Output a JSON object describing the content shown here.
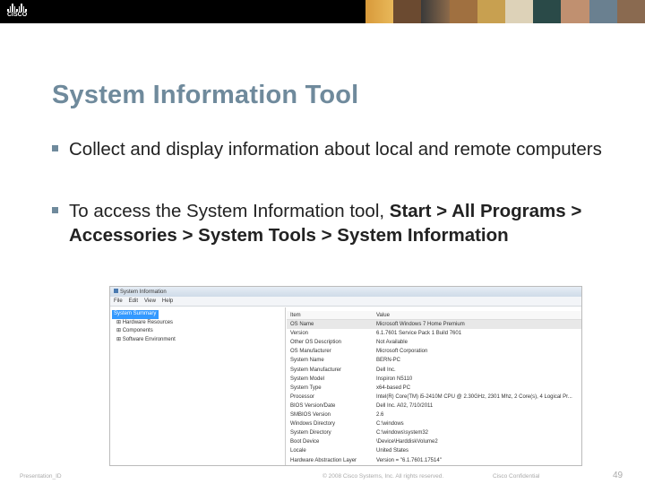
{
  "header": {
    "logo_text": "CISCO"
  },
  "title": "System Information Tool",
  "bullets": [
    {
      "text": "Collect and display information about local and remote computers"
    },
    {
      "text_plain": "To access the System Information tool, ",
      "text_bold": "Start > All Programs > Accessories > System Tools > System Information"
    }
  ],
  "screenshot": {
    "window_title": "System Information",
    "menu": [
      "File",
      "Edit",
      "View",
      "Help"
    ],
    "tree": [
      "System Summary",
      "Hardware Resources",
      "Components",
      "Software Environment"
    ],
    "columns": [
      "Item",
      "Value"
    ],
    "rows": [
      [
        "OS Name",
        "Microsoft Windows 7 Home Premium"
      ],
      [
        "Version",
        "6.1.7601 Service Pack 1 Build 7601"
      ],
      [
        "Other OS Description",
        "Not Available"
      ],
      [
        "OS Manufacturer",
        "Microsoft Corporation"
      ],
      [
        "System Name",
        "BERN-PC"
      ],
      [
        "System Manufacturer",
        "Dell Inc."
      ],
      [
        "System Model",
        "Inspiron N5110"
      ],
      [
        "System Type",
        "x64-based PC"
      ],
      [
        "Processor",
        "Intel(R) Core(TM) i5-2410M CPU @ 2.30GHz, 2301 Mhz, 2 Core(s), 4 Logical Pr..."
      ],
      [
        "BIOS Version/Date",
        "Dell Inc. A02, 7/10/2011"
      ],
      [
        "SMBIOS Version",
        "2.6"
      ],
      [
        "Windows Directory",
        "C:\\windows"
      ],
      [
        "System Directory",
        "C:\\windows\\system32"
      ],
      [
        "Boot Device",
        "\\Device\\HarddiskVolume2"
      ],
      [
        "Locale",
        "United States"
      ],
      [
        "Hardware Abstraction Layer",
        "Version = \"6.1.7601.17514\""
      ]
    ]
  },
  "footer": {
    "left": "Presentation_ID",
    "copyright": "© 2008 Cisco Systems, Inc. All rights reserved.",
    "confidential": "Cisco Confidential",
    "page": "49"
  }
}
